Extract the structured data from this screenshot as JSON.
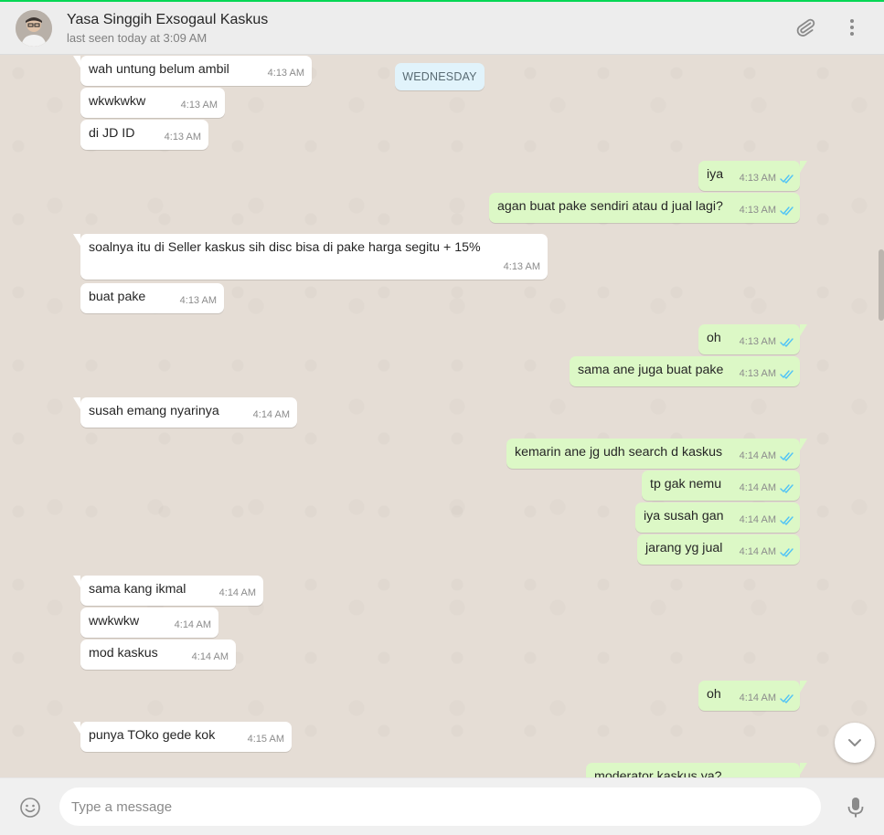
{
  "header": {
    "contact_name": "Yasa Singgih Exsogaul Kaskus",
    "status": "last seen today at 3:09 AM",
    "icons": [
      "avatar",
      "paperclip-icon",
      "menu-dots-icon"
    ]
  },
  "chat": {
    "day_label": "WEDNESDAY",
    "messages": [
      {
        "dir": "in",
        "text": "wah untung belum ambil",
        "time": "4:13 AM"
      },
      {
        "dir": "in",
        "text": "wkwkwkw",
        "time": "4:13 AM"
      },
      {
        "dir": "in",
        "text": "di JD ID",
        "time": "4:13 AM"
      },
      {
        "dir": "out",
        "text": "iya",
        "time": "4:13 AM",
        "read": true
      },
      {
        "dir": "out",
        "text": "agan buat pake sendiri atau d jual lagi?",
        "time": "4:13 AM",
        "read": true
      },
      {
        "dir": "in",
        "text": "soalnya itu di Seller kaskus sih disc bisa di pake harga segitu + 15%",
        "time": "4:13 AM"
      },
      {
        "dir": "in",
        "text": "buat pake",
        "time": "4:13 AM"
      },
      {
        "dir": "out",
        "text": "oh",
        "time": "4:13 AM",
        "read": true
      },
      {
        "dir": "out",
        "text": "sama ane juga buat pake",
        "time": "4:13 AM",
        "read": true
      },
      {
        "dir": "in",
        "text": "susah emang nyarinya",
        "time": "4:14 AM"
      },
      {
        "dir": "out",
        "text": "kemarin ane jg udh search d kaskus",
        "time": "4:14 AM",
        "read": true
      },
      {
        "dir": "out",
        "text": "tp gak nemu",
        "time": "4:14 AM",
        "read": true
      },
      {
        "dir": "out",
        "text": "iya susah gan",
        "time": "4:14 AM",
        "read": true
      },
      {
        "dir": "out",
        "text": "jarang yg jual",
        "time": "4:14 AM",
        "read": true
      },
      {
        "dir": "in",
        "text": "sama kang ikmal",
        "time": "4:14 AM"
      },
      {
        "dir": "in",
        "text": "wwkwkw",
        "time": "4:14 AM"
      },
      {
        "dir": "in",
        "text": "mod kaskus",
        "time": "4:14 AM"
      },
      {
        "dir": "out",
        "text": "oh",
        "time": "4:14 AM",
        "read": true
      },
      {
        "dir": "in",
        "text": "punya TOko gede kok",
        "time": "4:15 AM"
      },
      {
        "dir": "out",
        "text": "moderator kaskus ya?",
        "time": "",
        "read": true
      }
    ]
  },
  "composer": {
    "placeholder": "Type a message",
    "icons": [
      "emoji-icon",
      "microphone-icon"
    ]
  },
  "colors": {
    "incoming_bubble": "#ffffff",
    "outgoing_bubble": "#dcf8c6",
    "read_ticks": "#4fc3f7",
    "chat_background": "#e5ddd5"
  }
}
